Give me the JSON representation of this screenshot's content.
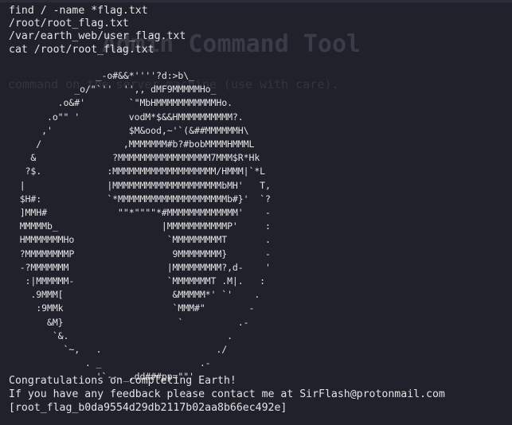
{
  "background": {
    "title": "Admin Command Tool",
    "subtitle": "command on the server machine (use with care)."
  },
  "commands": [
    "find / -name *flag.txt",
    "/root/root_flag.txt",
    "/var/earth_web/user_flag.txt",
    "cat /root/root_flag.txt"
  ],
  "ascii_art": [
    "                _-o#&&*''''?d:>b\\_",
    "            _o/\"`''  '',, dMF9MMMMMHo_",
    "         .o&#'        `\"MbHMMMMMMMMMMMHo.",
    "       .o\"\" '         vodM*$&&HMMMMMMMMMM?.",
    "      ,'              $M&ood,~'`(&##MMMMMMH\\",
    "     /               ,MMMMMMM#b?#bobMMMMHMMML",
    "    &              ?MMMMMMMMMMMMMMMMM7MMM$R*Hk",
    "   ?$.            :MMMMMMMMMMMMMMMMMMM/HMMM|`*L",
    "  |               |MMMMMMMMMMMMMMMMMMMMbMH'   T,",
    "  $H#:            `*MMMMMMMMMMMMMMMMMMMMb#}'  `?",
    "  ]MMH#             \"\"*\"\"\"\"*#MMMMMMMMMMMMM'    -",
    "  MMMMMb_                   |MMMMMMMMMMMP'     :",
    "  HMMMMMMMHo                 `MMMMMMMMMT       .",
    "  ?MMMMMMMMP                  9MMMMMMMM}       -",
    "  -?MMMMMMM                  |MMMMMMMMM?,d-    '",
    "   :|MMMMMM-                 `MMMMMMMT .M|.   :",
    "    .9MMM[                    &MMMMM*' `'    .",
    "     :9MMk                    `MMM#\"        -",
    "       &M}                     `          .-",
    "        `&.                             .",
    "          `~,   .                     ./",
    "              . _                  .-",
    "                '`--._,dd###pp=\"\"'"
  ],
  "footer": {
    "congrats": "Congratulations on completing Earth!",
    "feedback": "If you have any feedback please contact me at SirFlash@protonmail.com",
    "flag": "[root_flag_b0da9554d29db2117b02aa8b66ec492e]"
  }
}
